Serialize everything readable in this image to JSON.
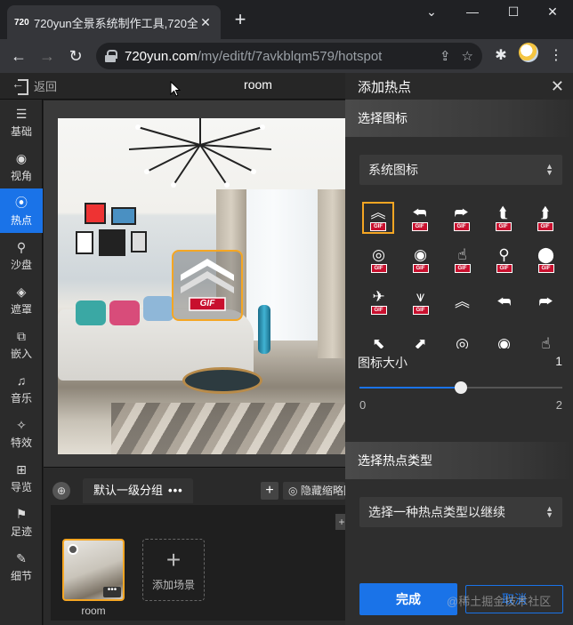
{
  "browser": {
    "tab_favicon": "720",
    "tab_title": "720yun全景系统制作工具,720全",
    "tab_close": "✕",
    "new_tab": "+",
    "window_controls": {
      "collapse": "⌄",
      "minimize": "—",
      "maximize": "☐",
      "close": "✕"
    },
    "nav": {
      "back": "←",
      "forward": "→",
      "reload": "↻"
    },
    "url_host": "720yun.com",
    "url_path": "/my/edit/t/7avkblqm579/hotspot",
    "icons": {
      "share": "share-icon",
      "star": "☆",
      "extensions": "puzzle-icon"
    }
  },
  "app": {
    "back_label": "返回",
    "scene_title": "room"
  },
  "sidebar": {
    "items": [
      {
        "icon": "☰",
        "label": "基础",
        "active": false
      },
      {
        "icon": "◉",
        "label": "视角",
        "active": false
      },
      {
        "icon": "⦿",
        "label": "热点",
        "active": true
      },
      {
        "icon": "⚲",
        "label": "沙盘",
        "active": false
      },
      {
        "icon": "◈",
        "label": "遮罩",
        "active": false
      },
      {
        "icon": "⧉",
        "label": "嵌入",
        "active": false
      },
      {
        "icon": "♫",
        "label": "音乐",
        "active": false
      },
      {
        "icon": "✧",
        "label": "特效",
        "active": false
      },
      {
        "icon": "⊞",
        "label": "导览",
        "active": false
      },
      {
        "icon": "⚑",
        "label": "足迹",
        "active": false
      },
      {
        "icon": "✎",
        "label": "细节",
        "active": false
      }
    ]
  },
  "hotspot_preview": {
    "gif_label": "GIF"
  },
  "scene_bar": {
    "group_name": "默认一级分组",
    "group_more": "•••",
    "add_group": "+",
    "hide_thumbnails": "隐藏缩略图",
    "collapse": "+",
    "scenes": [
      {
        "name": "room",
        "more": "•••"
      }
    ],
    "add_scene_plus": "+",
    "add_scene_label": "添加场景"
  },
  "panel": {
    "title": "添加热点",
    "close": "✕",
    "section_icon": "选择图标",
    "icon_set_selected": "系统图标",
    "icons": [
      {
        "glyph": "︽",
        "gif": true,
        "selected": true
      },
      {
        "glyph": "⮪",
        "gif": true,
        "selected": false
      },
      {
        "glyph": "⮫",
        "gif": true,
        "selected": false
      },
      {
        "glyph": "⮬",
        "gif": true,
        "selected": false
      },
      {
        "glyph": "⮭",
        "gif": true,
        "selected": false
      },
      {
        "glyph": "◎",
        "gif": true,
        "selected": false
      },
      {
        "glyph": "◉",
        "gif": true,
        "selected": false
      },
      {
        "glyph": "☝",
        "gif": true,
        "selected": false
      },
      {
        "glyph": "⚲",
        "gif": true,
        "selected": false
      },
      {
        "glyph": "⬤",
        "gif": true,
        "selected": false
      },
      {
        "glyph": "✈",
        "gif": true,
        "selected": false
      },
      {
        "glyph": "⩛",
        "gif": true,
        "selected": false
      },
      {
        "glyph": "︽",
        "gif": false,
        "selected": false
      },
      {
        "glyph": "⮪",
        "gif": false,
        "selected": false
      },
      {
        "glyph": "⮫",
        "gif": false,
        "selected": false
      },
      {
        "glyph": "⬉",
        "gif": false,
        "selected": false
      },
      {
        "glyph": "⬈",
        "gif": false,
        "selected": false
      },
      {
        "glyph": "◎",
        "gif": false,
        "selected": false
      },
      {
        "glyph": "◉",
        "gif": false,
        "selected": false
      },
      {
        "glyph": "☝",
        "gif": false,
        "selected": false
      }
    ],
    "gif_label": "GIF",
    "size_label": "图标大小",
    "size_value": "1",
    "size_min": "0",
    "size_max": "2",
    "size_fraction": 0.5,
    "section_type": "选择热点类型",
    "type_placeholder": "选择一种热点类型以继续",
    "done_button": "完成",
    "cancel_button": "取消"
  },
  "watermark": "@稀土掘金技术社区",
  "colors": {
    "accent": "#1a73e8",
    "selection": "#f5a623",
    "gif_red": "#c8102e"
  }
}
